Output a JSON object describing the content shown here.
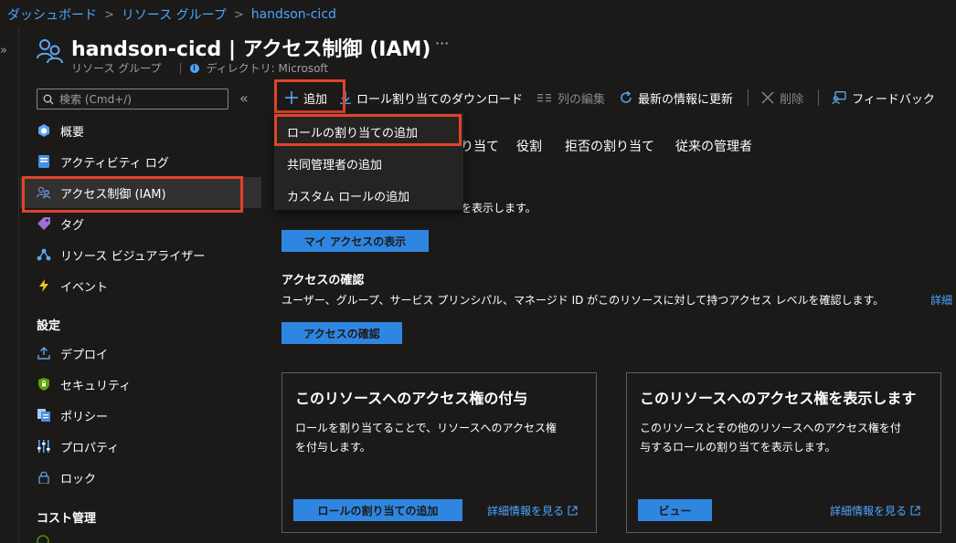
{
  "breadcrumb": [
    "ダッシュボード",
    "リソース グループ",
    "handson-cicd"
  ],
  "header": {
    "title": "handson-cicd | アクセス制御 (IAM)",
    "more": "···",
    "subtitle_type": "リソース グループ",
    "subtitle_dir": "ディレクトリ: Microsoft",
    "info_glyph": "i"
  },
  "sidebar": {
    "search_placeholder": "検索 (Cmd+/)",
    "collapse_glyph": "«",
    "rail_glyph": "»",
    "items": [
      {
        "label": "概要",
        "icon": "overview-icon"
      },
      {
        "label": "アクティビティ ログ",
        "icon": "activity-log-icon"
      },
      {
        "label": "アクセス制御 (IAM)",
        "icon": "iam-icon",
        "active": true
      },
      {
        "label": "タグ",
        "icon": "tag-icon"
      },
      {
        "label": "リソース ビジュアライザー",
        "icon": "visualizer-icon"
      },
      {
        "label": "イベント",
        "icon": "event-icon"
      }
    ],
    "section_settings": "設定",
    "settings_items": [
      {
        "label": "デプロイ",
        "icon": "deploy-icon"
      },
      {
        "label": "セキュリティ",
        "icon": "security-icon"
      },
      {
        "label": "ポリシー",
        "icon": "policy-icon"
      },
      {
        "label": "プロパティ",
        "icon": "properties-icon"
      },
      {
        "label": "ロック",
        "icon": "lock-icon"
      }
    ],
    "section_cost": "コスト管理"
  },
  "toolbar": {
    "add": "追加",
    "download": "ロール割り当てのダウンロード",
    "edit_columns": "列の編集",
    "refresh": "最新の情報に更新",
    "delete": "削除",
    "feedback": "フィードバック"
  },
  "add_menu": [
    "ロールの割り当ての追加",
    "共同管理者の追加",
    "カスタム ロールの追加"
  ],
  "tabs": [
    "り当て",
    "役割",
    "拒否の割り当て",
    "従来の管理者"
  ],
  "my_access": {
    "desc_tail": "を表示します。",
    "button": "マイ アクセスの表示"
  },
  "check_access": {
    "title": "アクセスの確認",
    "desc": "ユーザー、グループ、サービス プリンシパル、マネージド ID がこのリソースに対して持つアクセス レベルを確認します。",
    "link": "詳細",
    "button": "アクセスの確認"
  },
  "cards": [
    {
      "title": "このリソースへのアクセス権の付与",
      "desc": [
        "ロールを割り当てることで、リソースへのアクセス権",
        "を付与します。"
      ],
      "button": "ロールの割り当ての追加",
      "link": "詳細情報を見る"
    },
    {
      "title": "このリソースへのアクセス権を表示します",
      "desc": [
        "このリソースとその他のリソースへのアクセス権を付",
        "与するロールの割り当てを表示します。"
      ],
      "button": "ビュー",
      "link": "詳細情報を見る"
    }
  ],
  "colors": {
    "accent": "#2f86e0",
    "link": "#4ca6ff",
    "highlight": "#e0432b",
    "background": "#1b1a19"
  }
}
